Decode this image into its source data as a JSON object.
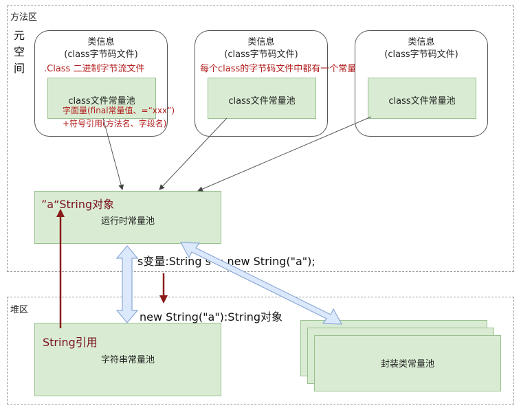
{
  "method_area": {
    "label": "方法区",
    "metaspace_label": [
      "元",
      "空",
      "间"
    ]
  },
  "class_info": [
    {
      "title": "类信息",
      "subtitle": "(class字节码文件)",
      "pool_label": "class文件常量池",
      "note_top": ".Class 二进制字节流文件",
      "note_lines": [
        "字面量(final常量值、=“xxx”)",
        "+符号引用(方法名、字段名)"
      ]
    },
    {
      "title": "类信息",
      "subtitle": "(class字节码文件)",
      "pool_label": "class文件常量池",
      "note_top": "每个class的字节码文件中都有一个常量池"
    },
    {
      "title": "类信息",
      "subtitle": "(class字节码文件)",
      "pool_label": "class文件常量池"
    }
  ],
  "runtime_pool": {
    "label": "运行时常量池",
    "object_label": "”a“String对象"
  },
  "annotations": {
    "s_var": "s变量:String s = new String(\"a\");",
    "new_string": "new String(\"a\"):String对象",
    "string_ref": "String引用"
  },
  "heap": {
    "label": "堆区",
    "string_pool_label": "字符串常量池",
    "wrapper_pool_label": "封装类常量池"
  },
  "colors": {
    "green_fill": "#d9ecd3",
    "green_border": "#99c08f",
    "note_red": "#b31d1d",
    "arrow_maroon": "#8b1a1a",
    "blue_arrow_fill": "#dce8fb",
    "blue_arrow_stroke": "#8aa9d6"
  }
}
